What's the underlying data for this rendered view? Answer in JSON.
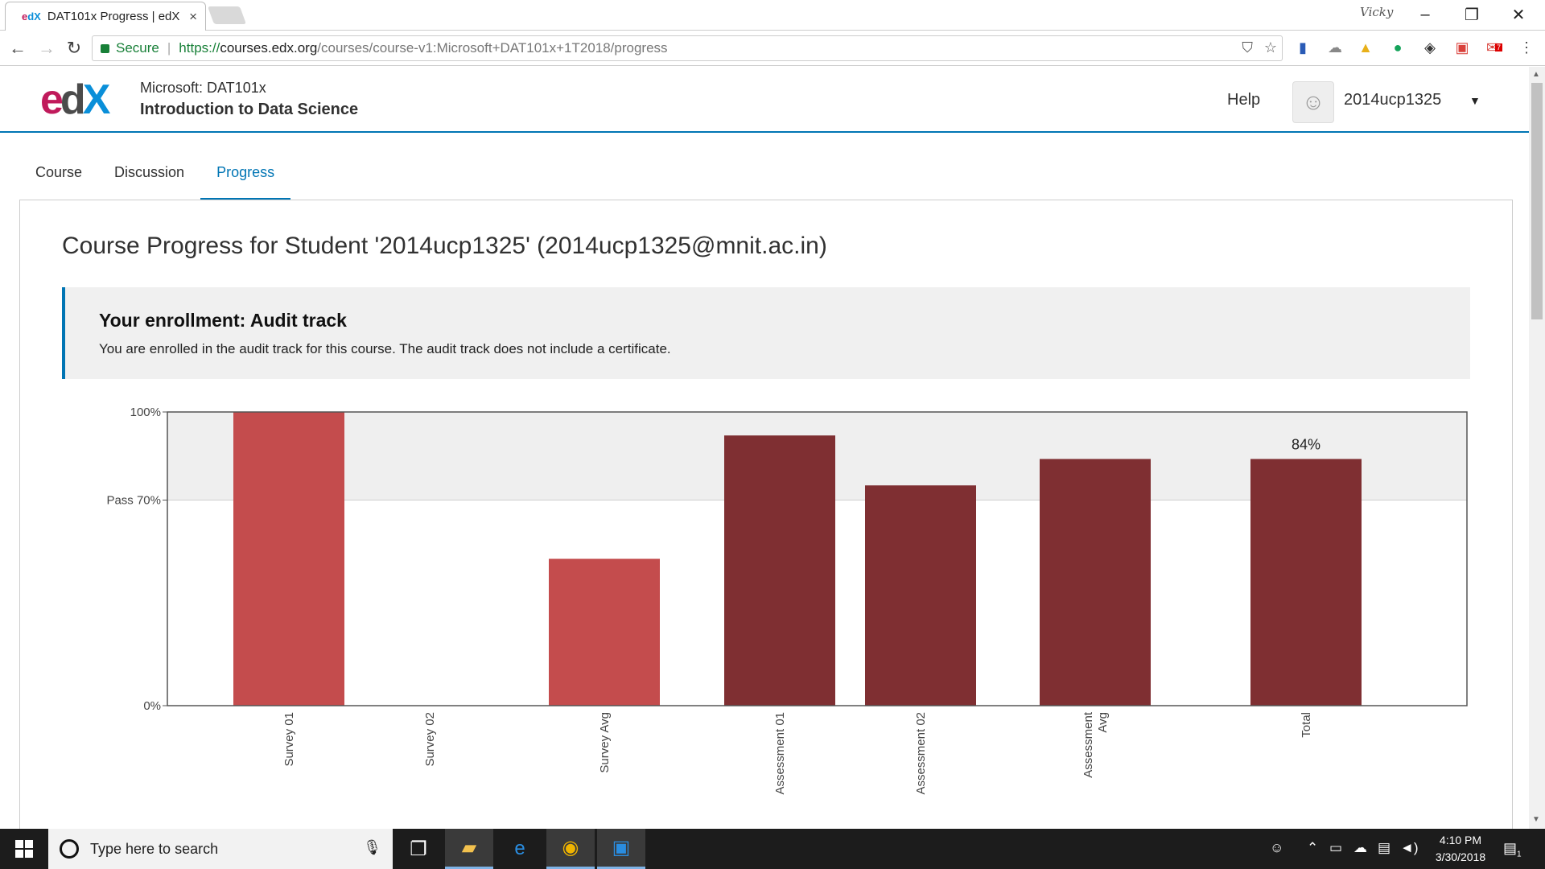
{
  "browser": {
    "tab_title": "DAT101x Progress | edX",
    "tab_favicon_e": "e",
    "tab_favicon_dx": "dX",
    "tab_close": "×",
    "profile_name": "Vicky",
    "window_controls": [
      "–",
      "❐",
      "✕"
    ],
    "secure_label": "Secure",
    "url_scheme": "https://",
    "url_host": "courses.edx.org",
    "url_path": "/courses/course-v1:Microsoft+DAT101x+1T2018/progress",
    "extensions": [
      "bookmark-icon",
      "cloud-icon",
      "drive-icon",
      "grammarly-icon",
      "lightbulb-icon",
      "toolbox-icon",
      "mail-icon"
    ],
    "extension_badge": "7",
    "menu_icon": "⋮"
  },
  "header": {
    "logo_e": "e",
    "logo_d": "d",
    "logo_x": "X",
    "course_org": "Microsoft: DAT101x",
    "course_name": "Introduction to Data Science",
    "help": "Help",
    "username": "2014ucp1325"
  },
  "tabs": [
    {
      "label": "Course",
      "active": false
    },
    {
      "label": "Discussion",
      "active": false
    },
    {
      "label": "Progress",
      "active": true
    }
  ],
  "main": {
    "page_title": "Course Progress for Student '2014ucp1325' (2014ucp1325@mnit.ac.in)",
    "enrollment_title": "Your enrollment: Audit track",
    "enrollment_message": "You are enrolled in the audit track for this course. The audit track does not include a certificate."
  },
  "chart_data": {
    "type": "bar",
    "categories": [
      "Survey 01",
      "Survey 02",
      "Survey Avg",
      "Assessment 01",
      "Assessment 02",
      "Assessment Avg",
      "Total"
    ],
    "values": [
      100,
      0,
      50,
      92,
      75,
      84,
      84
    ],
    "series_colors": [
      "#c44c4d",
      "#c44c4d",
      "#c44c4d",
      "#7f2f32",
      "#7f2f32",
      "#7f2f32",
      "#7f2f32"
    ],
    "ylim": [
      0,
      100
    ],
    "yticks": [
      {
        "value": 100,
        "label": "100%"
      },
      {
        "value": 70,
        "label": "Pass 70%"
      },
      {
        "value": 0,
        "label": "0%"
      }
    ],
    "pass_threshold": 70,
    "data_labels": [
      {
        "category": "Total",
        "text": "84%"
      }
    ],
    "grid": false
  },
  "taskbar": {
    "search_placeholder": "Type here to search",
    "time": "4:10 PM",
    "date": "3/30/2018",
    "notification_count": "1"
  }
}
